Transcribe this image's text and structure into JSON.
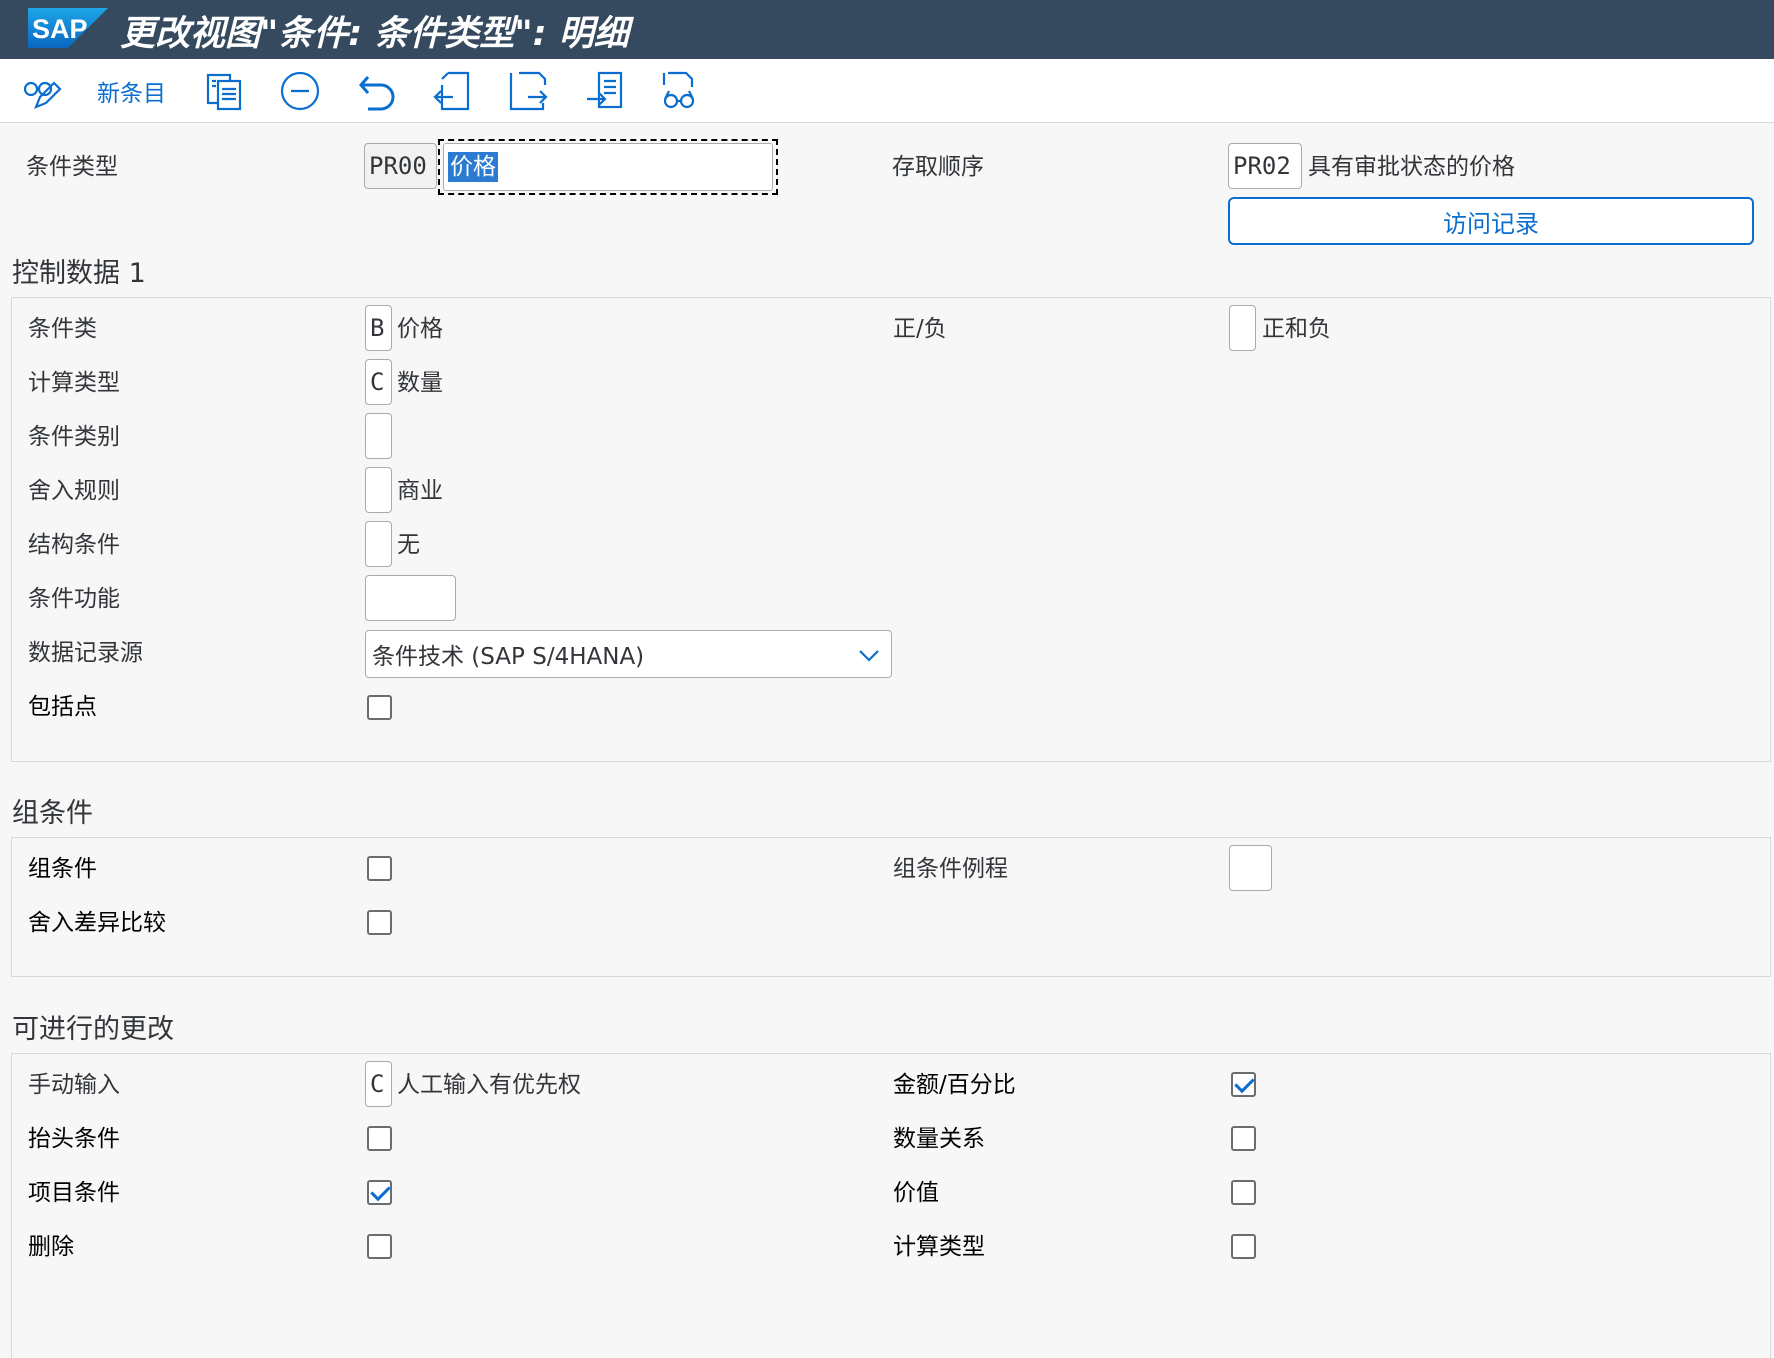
{
  "title": "更改视图\"条件: 条件类型\": 明细",
  "logo": "SAP",
  "toolbar": {
    "new_entries": "新条目"
  },
  "header": {
    "cond_type_label": "条件类型",
    "cond_type_code": "PR00",
    "cond_type_name": "价格",
    "access_seq_label": "存取顺序",
    "access_seq_code": "PR02",
    "access_seq_name": "具有审批状态的价格",
    "access_records_button": "访问记录"
  },
  "control1": {
    "title": "控制数据 1",
    "cond_class_label": "条件类",
    "cond_class_code": "B",
    "cond_class_text": "价格",
    "plus_minus_label": "正/负",
    "plus_minus_code": "",
    "plus_minus_text": "正和负",
    "calc_type_label": "计算类型",
    "calc_type_code": "C",
    "calc_type_text": "数量",
    "cond_category_label": "条件类别",
    "cond_category_code": "",
    "rounding_label": "舍入规则",
    "rounding_code": "",
    "rounding_text": "商业",
    "struct_cond_label": "结构条件",
    "struct_cond_code": "",
    "struct_cond_text": "无",
    "cond_function_label": "条件功能",
    "cond_function_code": "",
    "data_source_label": "数据记录源",
    "data_source_value": "条件技术 (SAP S/4HANA)",
    "inclusion_label": "包括点",
    "inclusion_checked": false
  },
  "group_cond": {
    "title": "组条件",
    "group_cond_label": "组条件",
    "group_cond_checked": false,
    "group_routine_label": "组条件例程",
    "group_routine_value": "",
    "rounding_diff_label": "舍入差异比较",
    "rounding_diff_checked": false
  },
  "changes": {
    "title": "可进行的更改",
    "manual_entry_label": "手动输入",
    "manual_entry_code": "C",
    "manual_entry_text": "人工输入有优先权",
    "amount_percent_label": "金额/百分比",
    "amount_percent_checked": true,
    "header_cond_label": "抬头条件",
    "header_cond_checked": false,
    "qty_relation_label": "数量关系",
    "qty_relation_checked": false,
    "item_cond_label": "项目条件",
    "item_cond_checked": true,
    "value_label": "价值",
    "value_checked": false,
    "delete_label": "删除",
    "delete_checked": false,
    "calc_type_label": "计算类型",
    "calc_type_checked": false
  },
  "colors": {
    "shell": "#354a5f",
    "accent": "#0a6ed1",
    "selection": "#2a7bd1"
  }
}
